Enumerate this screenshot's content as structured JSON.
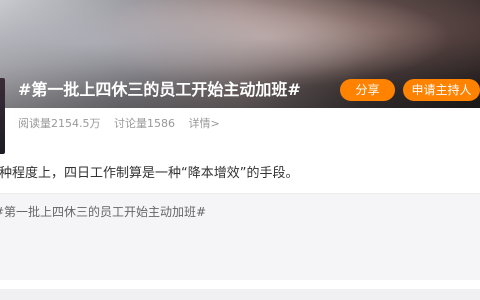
{
  "topic": {
    "title": "#第一批上四休三的员工开始主动加班#",
    "share_label": "分享",
    "apply_host_label": "申请主持人"
  },
  "stats": {
    "reads": "阅读量2154.5万",
    "discussions": "讨论量1586",
    "detail_link": "详情>"
  },
  "summary": {
    "text": "某种程度上，四日工作制算是一种“降本增效”的手段。"
  },
  "composer": {
    "prefill": "#第一批上四休三的员工开始主动加班#"
  },
  "colors": {
    "accent": "#ff8200"
  }
}
